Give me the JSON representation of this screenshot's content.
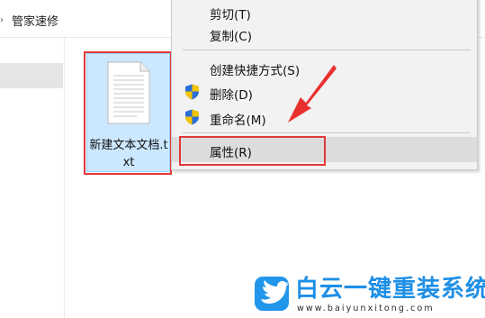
{
  "address_bar": {
    "path": "管家速修"
  },
  "file": {
    "name": "新建文本文档.txt"
  },
  "context_menu": {
    "items": [
      {
        "label": "剪切(T)"
      },
      {
        "label": "复制(C)"
      },
      {
        "label": "创建快捷方式(S)"
      },
      {
        "label": "删除(D)"
      },
      {
        "label": "重命名(M)"
      },
      {
        "label": "属性(R)"
      }
    ]
  },
  "watermark": {
    "brand": "白云一键重装系统",
    "url": "www.baiyunxitong.com"
  },
  "colors": {
    "annotation_red": "#e03a3a",
    "selection_blue": "#cce8ff",
    "brand_blue": "#1e8fe6"
  },
  "icons": [
    "chevron-right-icon",
    "text-file-icon",
    "uac-shield-icon",
    "pointer-arrow-icon",
    "bird-logo-icon"
  ]
}
